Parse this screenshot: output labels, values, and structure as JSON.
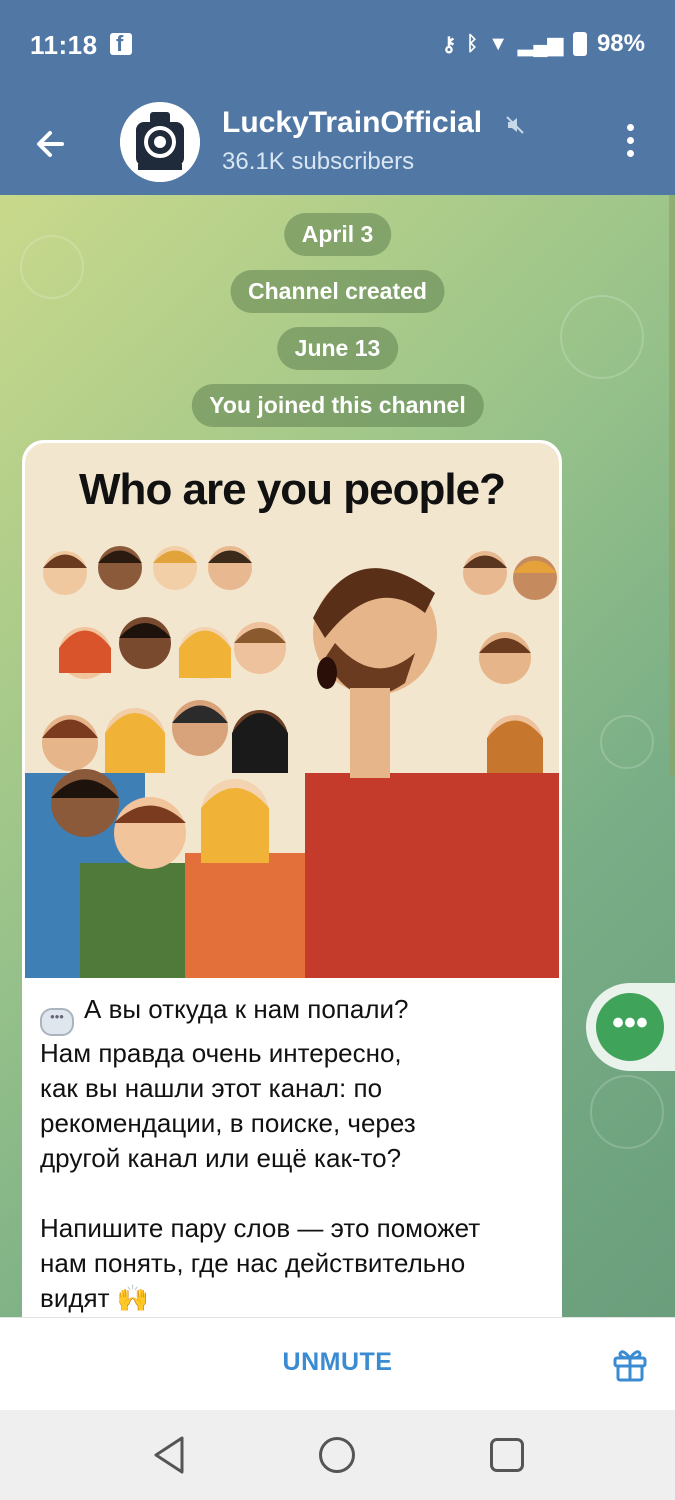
{
  "status": {
    "time": "11:18",
    "battery": "98%",
    "icons": [
      "facebook-icon",
      "key-icon",
      "bluetooth-icon",
      "wifi-icon",
      "signal-icon",
      "battery-icon"
    ]
  },
  "header": {
    "title": "LuckyTrainOfficial",
    "subtitle": "36.1K subscribers",
    "muted": true
  },
  "chat": {
    "service_messages": [
      "April 3",
      "Channel created",
      "June 13",
      "You joined this channel"
    ],
    "post": {
      "image_title": "Who are you people?",
      "text_lines": [
        "А вы откуда к нам попали?",
        "Нам правда очень интересно,",
        "как вы нашли этот канал: по",
        "рекомендации, в поиске, через",
        "другой канал или ещё как-то?",
        "",
        "Напишите пару слов — это поможет",
        "нам понять, где нас действительно",
        "видят 🙌"
      ]
    }
  },
  "footer": {
    "unmute_label": "UNMUTE"
  },
  "colors": {
    "header": "#5178a5",
    "accent": "#3a8bd2",
    "fab": "#3fa35a"
  }
}
